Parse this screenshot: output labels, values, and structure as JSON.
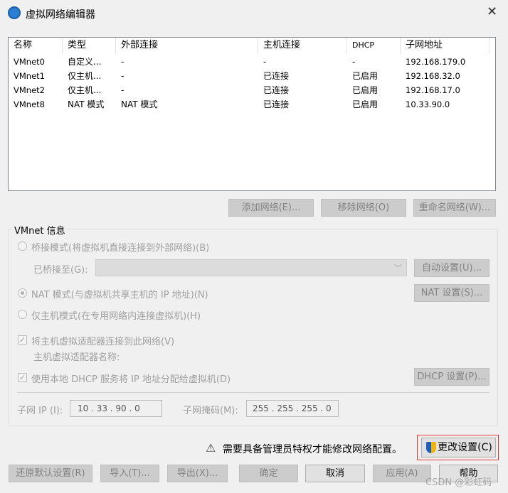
{
  "window": {
    "title": "虚拟网络编辑器",
    "close": "✕"
  },
  "table": {
    "headers": [
      "名称",
      "类型",
      "外部连接",
      "主机连接",
      "DHCP",
      "子网地址"
    ],
    "rows": [
      [
        "VMnet0",
        "自定义...",
        "-",
        "-",
        "-",
        "192.168.179.0"
      ],
      [
        "VMnet1",
        "仅主机...",
        "-",
        "已连接",
        "已启用",
        "192.168.32.0"
      ],
      [
        "VMnet2",
        "仅主机...",
        "-",
        "已连接",
        "已启用",
        "192.168.17.0"
      ],
      [
        "VMnet8",
        "NAT 模式",
        "NAT 模式",
        "已连接",
        "已启用",
        "10.33.90.0"
      ]
    ]
  },
  "net_buttons": {
    "add": "添加网络(E)...",
    "remove": "移除网络(O)",
    "rename": "重命名网络(W)..."
  },
  "info": {
    "legend": "VMnet 信息",
    "bridged": "桥接模式(将虚拟机直接连接到外部网络)(B)",
    "bridged_to": "已桥接至(G):",
    "auto": "自动设置(U)...",
    "nat": "NAT 模式(与虚拟机共享主机的 IP 地址)(N)",
    "nat_settings": "NAT 设置(S)...",
    "hostonly": "仅主机模式(在专用网络内连接虚拟机)(H)",
    "connect_adapter": "将主机虚拟适配器连接到此网络(V)",
    "adapter_name": "主机虚拟适配器名称:",
    "dhcp": "使用本地 DHCP 服务将 IP 地址分配给虚拟机(D)",
    "dhcp_settings": "DHCP 设置(P)...",
    "subnet_ip_label": "子网 IP (I):",
    "subnet_ip": "10 . 33 . 90 . 0",
    "mask_label": "子网掩码(M):",
    "mask": "255 . 255 . 255 . 0"
  },
  "warning": "需要具备管理员特权才能修改网络配置。",
  "change_settings": "更改设置(C)",
  "bottom": {
    "restore": "还原默认设置(R)",
    "import": "导入(T)...",
    "export": "导出(X)...",
    "ok": "确定",
    "cancel": "取消",
    "apply": "应用(A)",
    "help": "帮助"
  },
  "watermark": "CSDN @彩虹码"
}
